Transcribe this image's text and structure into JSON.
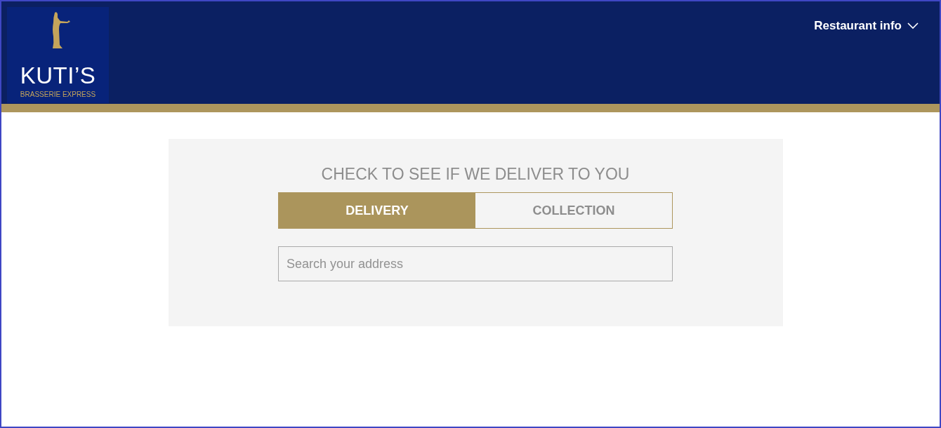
{
  "header": {
    "logo": {
      "name": "KUTI’S",
      "tagline": "BRASSERIE EXPRESS"
    },
    "menu": {
      "label": "Restaurant info",
      "expanded": false
    }
  },
  "delivery_check": {
    "title": "CHECK TO SEE IF WE DELIVER TO YOU",
    "tabs": [
      {
        "label": "DELIVERY",
        "selected": true
      },
      {
        "label": "COLLECTION",
        "selected": false
      }
    ],
    "search": {
      "placeholder": "Search your address"
    }
  }
}
